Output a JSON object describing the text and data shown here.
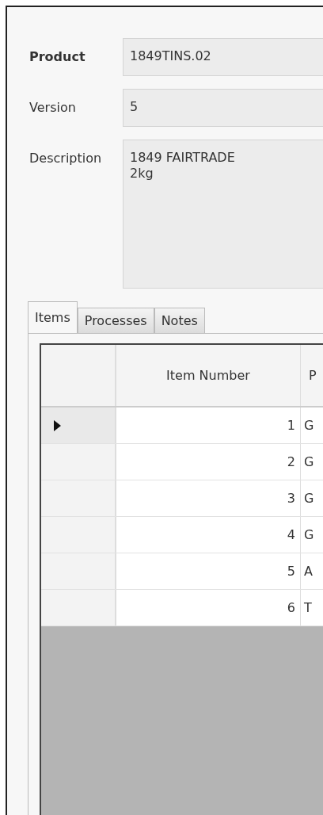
{
  "form": {
    "fields": [
      {
        "label": "Product",
        "value": "1849TINS.02",
        "kind": "line",
        "bold": true
      },
      {
        "label": "Version",
        "value": "5",
        "kind": "line",
        "bold": false
      },
      {
        "label": "Description",
        "value": "1849 FAIRTRADE\n2kg",
        "kind": "multiline",
        "bold": false
      }
    ]
  },
  "tabs": [
    {
      "label": "Items",
      "selected": true
    },
    {
      "label": "Processes",
      "selected": false
    },
    {
      "label": "Notes",
      "selected": false
    }
  ],
  "table": {
    "columns": [
      "Item Number",
      "P"
    ],
    "rows": [
      {
        "cells": [
          "1",
          "G"
        ],
        "selected": true
      },
      {
        "cells": [
          "2",
          "G"
        ],
        "selected": false
      },
      {
        "cells": [
          "3",
          "G"
        ],
        "selected": false
      },
      {
        "cells": [
          "4",
          "G"
        ],
        "selected": false
      },
      {
        "cells": [
          "5",
          "A"
        ],
        "selected": false
      },
      {
        "cells": [
          "6",
          "T"
        ],
        "selected": false
      }
    ]
  }
}
